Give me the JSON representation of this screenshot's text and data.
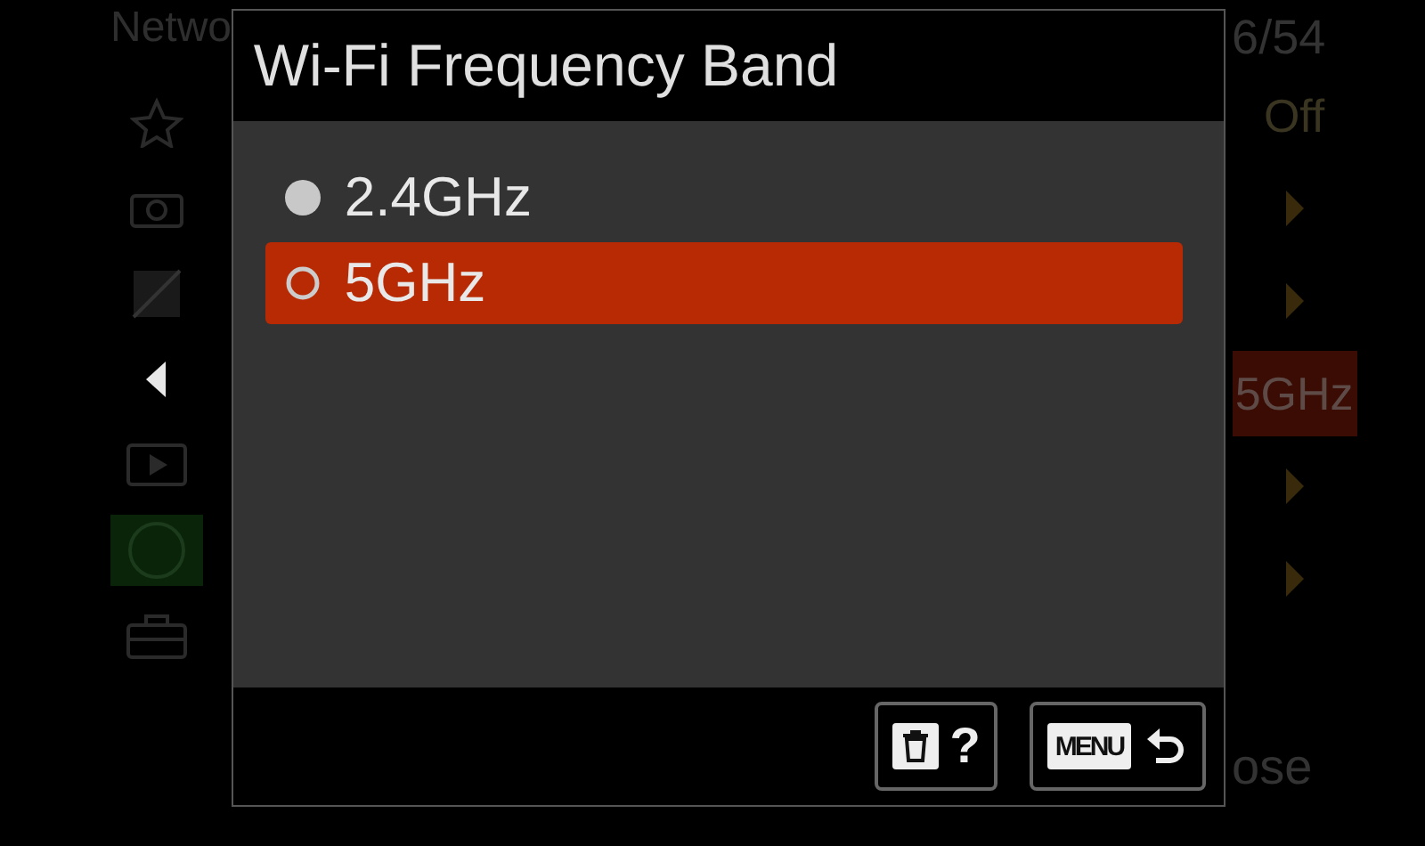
{
  "background_menu": {
    "title": "Netwo",
    "page": "6/54",
    "tabs": [
      {
        "kind": "star",
        "selected": false
      },
      {
        "kind": "camera",
        "selected": false
      },
      {
        "kind": "exposure",
        "selected": false
      },
      {
        "kind": "back",
        "selected": false
      },
      {
        "kind": "play",
        "selected": false
      },
      {
        "kind": "network",
        "selected": true
      },
      {
        "kind": "toolbox",
        "selected": false
      }
    ],
    "rows": [
      {
        "kind": "value",
        "value": "Off",
        "selected": false
      },
      {
        "kind": "arrow",
        "selected": false
      },
      {
        "kind": "arrow",
        "selected": false
      },
      {
        "kind": "value",
        "value": "5GHz",
        "selected": true
      },
      {
        "kind": "arrow",
        "selected": false
      },
      {
        "kind": "arrow",
        "selected": false
      }
    ],
    "footer": "ose"
  },
  "dialog": {
    "title": "Wi-Fi Frequency Band",
    "options": [
      {
        "label": "2.4GHz",
        "selected": false
      },
      {
        "label": "5GHz",
        "selected": true
      }
    ],
    "buttons": [
      {
        "kind": "delete-help",
        "label": "?"
      },
      {
        "kind": "menu-back",
        "label": "MENU"
      }
    ]
  }
}
